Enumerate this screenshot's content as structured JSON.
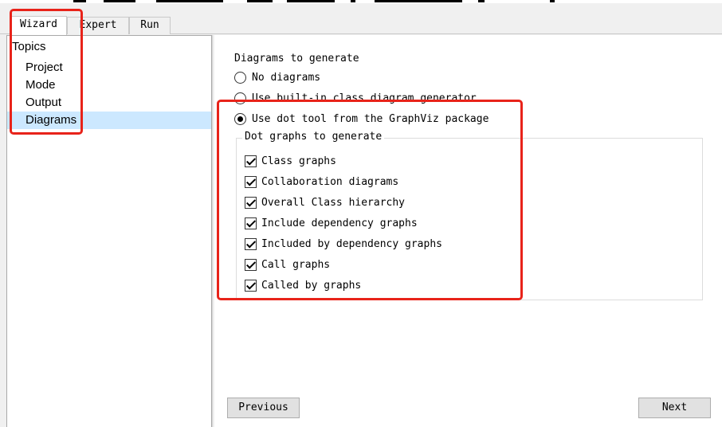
{
  "tabs": [
    "Wizard",
    "Expert",
    "Run"
  ],
  "topics": {
    "root": "Topics",
    "items": [
      "Project",
      "Mode",
      "Output",
      "Diagrams"
    ],
    "selected": "Diagrams"
  },
  "diagrams": {
    "section_title": "Diagrams to generate",
    "radio_options": [
      {
        "label": "No diagrams",
        "checked": false
      },
      {
        "label": "Use built-in class diagram generator",
        "checked": false
      },
      {
        "label": "Use dot tool from the GraphViz package",
        "checked": true
      }
    ],
    "dot_group": {
      "title": "Dot graphs to generate",
      "options": [
        {
          "label": "Class graphs",
          "checked": true
        },
        {
          "label": "Collaboration diagrams",
          "checked": true
        },
        {
          "label": "Overall Class hierarchy",
          "checked": true
        },
        {
          "label": "Include dependency graphs",
          "checked": true
        },
        {
          "label": "Included by dependency graphs",
          "checked": true
        },
        {
          "label": "Call graphs",
          "checked": true
        },
        {
          "label": "Called by graphs",
          "checked": true
        }
      ]
    }
  },
  "buttons": {
    "previous": "Previous",
    "next": "Next"
  },
  "colors": {
    "highlight": "#e8231a",
    "selection": "#cce8ff"
  }
}
